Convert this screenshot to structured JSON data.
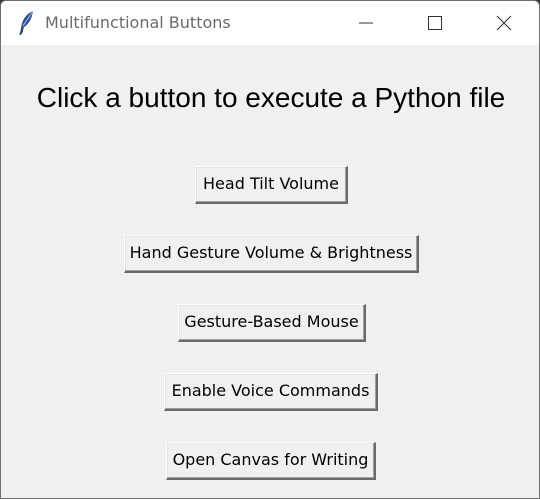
{
  "window": {
    "title": "Multifunctional Buttons",
    "app_icon": "feather-icon",
    "controls": {
      "minimize_icon": "minimize-icon",
      "maximize_icon": "maximize-icon",
      "close_icon": "close-icon"
    }
  },
  "main": {
    "heading": "Click a button to execute a Python file",
    "buttons": [
      {
        "label": "Head Tilt Volume"
      },
      {
        "label": "Hand Gesture Volume & Brightness"
      },
      {
        "label": "Gesture-Based Mouse"
      },
      {
        "label": "Enable Voice Commands"
      },
      {
        "label": "Open Canvas for Writing"
      }
    ]
  },
  "colors": {
    "background": "#f0f0f0",
    "titlebar": "#ffffff",
    "title_text": "#6b6b6b"
  }
}
